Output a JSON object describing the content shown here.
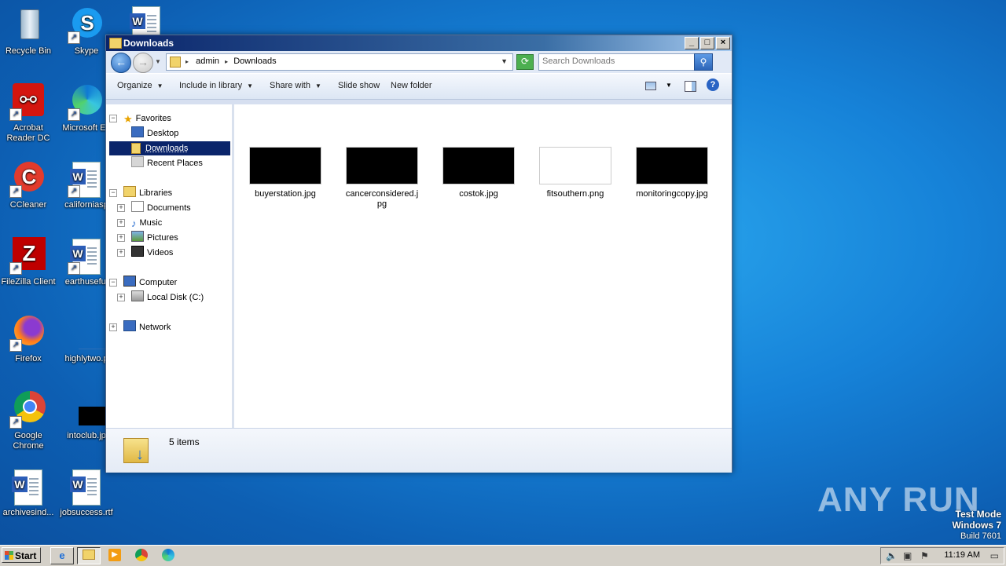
{
  "desktop": {
    "icons": [
      {
        "label": "Recycle Bin",
        "icon": "recycle-bin-icon"
      },
      {
        "label": "Skype",
        "icon": "skype-icon"
      },
      {
        "label": "",
        "icon": "word-document-icon"
      },
      {
        "label": "Acrobat Reader DC",
        "icon": "acrobat-icon"
      },
      {
        "label": "Microsoft Ed",
        "icon": "edge-icon"
      },
      {
        "label": "CCleaner",
        "icon": "ccleaner-icon"
      },
      {
        "label": "californiasp",
        "icon": "word-document-icon"
      },
      {
        "label": "FileZilla Client",
        "icon": "filezilla-icon"
      },
      {
        "label": "earthuseful",
        "icon": "word-document-icon"
      },
      {
        "label": "Firefox",
        "icon": "firefox-icon"
      },
      {
        "label": "highlytwo.p",
        "icon": "image-file-icon"
      },
      {
        "label": "Google Chrome",
        "icon": "chrome-icon"
      },
      {
        "label": "intoclub.jp",
        "icon": "image-file-icon"
      },
      {
        "label": "archivesind...",
        "icon": "word-document-icon"
      },
      {
        "label": "jobsuccess.rtf",
        "icon": "word-document-icon"
      }
    ],
    "watermark": "ANY RUN",
    "test_mode": {
      "line1": "Test Mode",
      "line2": "Windows 7",
      "line3": "Build 7601"
    }
  },
  "window": {
    "title": "Downloads",
    "controls": {
      "minimize": "_",
      "maximize": "□",
      "close": "×"
    },
    "address": {
      "crumbs": [
        "admin",
        "Downloads"
      ],
      "sep": "▸"
    },
    "search": {
      "placeholder": "Search Downloads"
    },
    "toolbar": {
      "organize": "Organize",
      "include_in_library": "Include in library",
      "share_with": "Share with",
      "slide_show": "Slide show",
      "new_folder": "New folder"
    },
    "nav": {
      "favorites": "Favorites",
      "desktop": "Desktop",
      "downloads": "Downloads",
      "recent_places": "Recent Places",
      "libraries": "Libraries",
      "documents": "Documents",
      "music": "Music",
      "pictures": "Pictures",
      "videos": "Videos",
      "computer": "Computer",
      "local_disk": "Local Disk (C:)",
      "network": "Network"
    },
    "files": [
      {
        "name": "buyerstation.jpg",
        "thumb": "#000000"
      },
      {
        "name": "cancerconsidered.jpg",
        "thumb": "#000000"
      },
      {
        "name": "costok.jpg",
        "thumb": "#000000"
      },
      {
        "name": "fitsouthern.png",
        "thumb": "#ffffff"
      },
      {
        "name": "monitoringcopy.jpg",
        "thumb": "#000000"
      }
    ],
    "status": {
      "items": "5 items"
    }
  },
  "taskbar": {
    "start": "Start",
    "clock": "11:19 AM"
  }
}
